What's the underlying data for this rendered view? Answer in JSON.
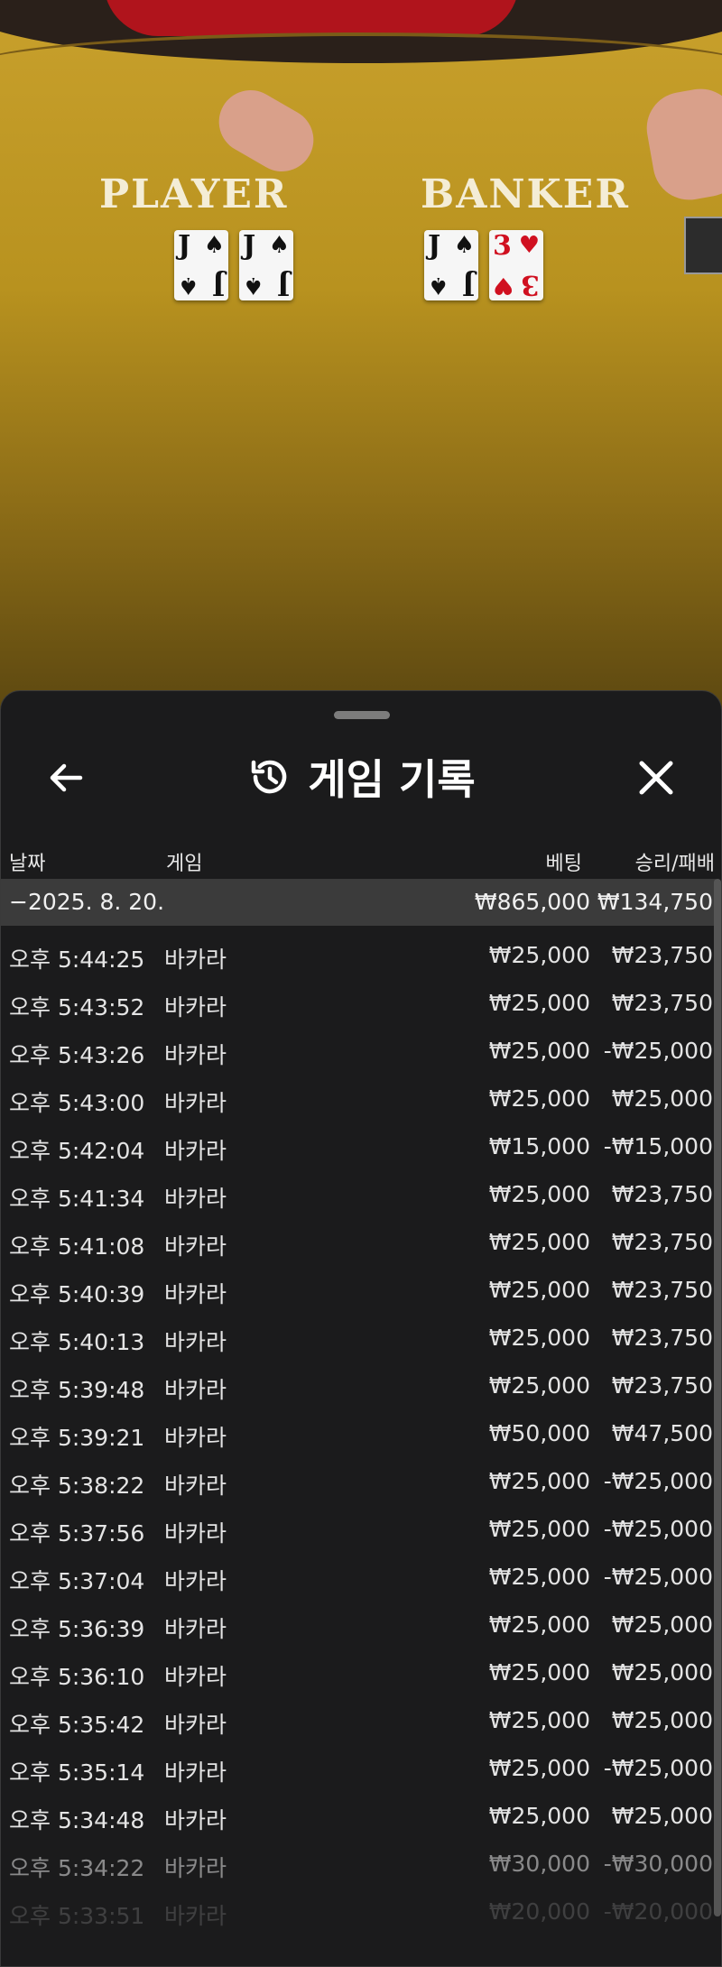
{
  "table": {
    "player_label": "PLAYER",
    "banker_label": "BANKER",
    "player_cards": [
      {
        "rank": "J",
        "suit": "♠",
        "color": "#111111"
      },
      {
        "rank": "J",
        "suit": "♠",
        "color": "#111111"
      }
    ],
    "banker_cards": [
      {
        "rank": "J",
        "suit": "♠",
        "color": "#111111"
      },
      {
        "rank": "3",
        "suit": "♥",
        "color": "#d01020"
      }
    ]
  },
  "header": {
    "title": "게임 기록",
    "back_icon": "arrow-left-icon",
    "history_icon": "history-icon",
    "close_icon": "close-icon"
  },
  "columns": {
    "date": "날짜",
    "game": "게임",
    "bet": "베팅",
    "result": "승리/패배"
  },
  "day_summary": {
    "date": "−2025. 8. 20.",
    "bet_total": "₩865,000",
    "result_total": "₩134,750"
  },
  "rows": [
    {
      "time": "오후 5:44:25",
      "game": "바카라",
      "bet": "₩25,000",
      "result": "₩23,750"
    },
    {
      "time": "오후 5:43:52",
      "game": "바카라",
      "bet": "₩25,000",
      "result": "₩23,750"
    },
    {
      "time": "오후 5:43:26",
      "game": "바카라",
      "bet": "₩25,000",
      "result": "-₩25,000"
    },
    {
      "time": "오후 5:43:00",
      "game": "바카라",
      "bet": "₩25,000",
      "result": "₩25,000"
    },
    {
      "time": "오후 5:42:04",
      "game": "바카라",
      "bet": "₩15,000",
      "result": "-₩15,000"
    },
    {
      "time": "오후 5:41:34",
      "game": "바카라",
      "bet": "₩25,000",
      "result": "₩23,750"
    },
    {
      "time": "오후 5:41:08",
      "game": "바카라",
      "bet": "₩25,000",
      "result": "₩23,750"
    },
    {
      "time": "오후 5:40:39",
      "game": "바카라",
      "bet": "₩25,000",
      "result": "₩23,750"
    },
    {
      "time": "오후 5:40:13",
      "game": "바카라",
      "bet": "₩25,000",
      "result": "₩23,750"
    },
    {
      "time": "오후 5:39:48",
      "game": "바카라",
      "bet": "₩25,000",
      "result": "₩23,750"
    },
    {
      "time": "오후 5:39:21",
      "game": "바카라",
      "bet": "₩50,000",
      "result": "₩47,500"
    },
    {
      "time": "오후 5:38:22",
      "game": "바카라",
      "bet": "₩25,000",
      "result": "-₩25,000"
    },
    {
      "time": "오후 5:37:56",
      "game": "바카라",
      "bet": "₩25,000",
      "result": "-₩25,000"
    },
    {
      "time": "오후 5:37:04",
      "game": "바카라",
      "bet": "₩25,000",
      "result": "-₩25,000"
    },
    {
      "time": "오후 5:36:39",
      "game": "바카라",
      "bet": "₩25,000",
      "result": "₩25,000"
    },
    {
      "time": "오후 5:36:10",
      "game": "바카라",
      "bet": "₩25,000",
      "result": "₩25,000"
    },
    {
      "time": "오후 5:35:42",
      "game": "바카라",
      "bet": "₩25,000",
      "result": "₩25,000"
    },
    {
      "time": "오후 5:35:14",
      "game": "바카라",
      "bet": "₩25,000",
      "result": "-₩25,000"
    },
    {
      "time": "오후 5:34:48",
      "game": "바카라",
      "bet": "₩25,000",
      "result": "₩25,000"
    },
    {
      "time": "오후 5:34:22",
      "game": "바카라",
      "bet": "₩30,000",
      "result": "-₩30,000"
    },
    {
      "time": "오후 5:33:51",
      "game": "바카라",
      "bet": "₩20,000",
      "result": "-₩20,000"
    }
  ]
}
